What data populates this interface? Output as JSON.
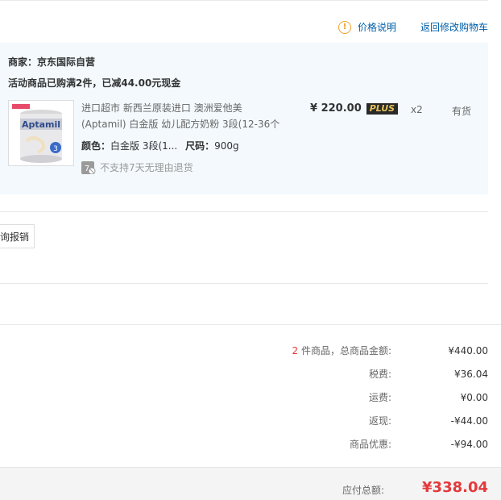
{
  "header": {
    "price_info_link": "价格说明",
    "back_to_cart_link": "返回修改购物车"
  },
  "shop": {
    "merchant": "商家：京东国际自营",
    "promo": "活动商品已购满2件，已减44.00元现金"
  },
  "item": {
    "name": "进口超市 新西兰原装进口 澳洲爱他美(Aptamil) 白金版 幼儿配方奶粉 3段(12-36个",
    "color_label": "颜色：",
    "color_value": "白金版 3段(1...",
    "size_label": "尺码：",
    "size_value": "900g",
    "no_return_text": "不支持7天无理由退货",
    "price": "¥ 220.00",
    "plus_badge": "PLUS",
    "quantity": "x2",
    "stock": "有货"
  },
  "invoice_button": "询报销",
  "summary": {
    "count": "2",
    "count_suffix": " 件商品，总商品金额:",
    "total_goods": "¥440.00",
    "tax_label": "税费:",
    "tax": "¥36.04",
    "shipping_label": "运费:",
    "shipping": "¥0.00",
    "cashback_label": "返现:",
    "cashback": "-¥44.00",
    "discount_label": "商品优惠:",
    "discount": "-¥94.00"
  },
  "total": {
    "label": "应付总额:",
    "value": "¥338.04"
  },
  "colors": {
    "accent_red": "#e4393c",
    "link_blue": "#005ea7",
    "shop_bg": "#f3f9fd"
  }
}
